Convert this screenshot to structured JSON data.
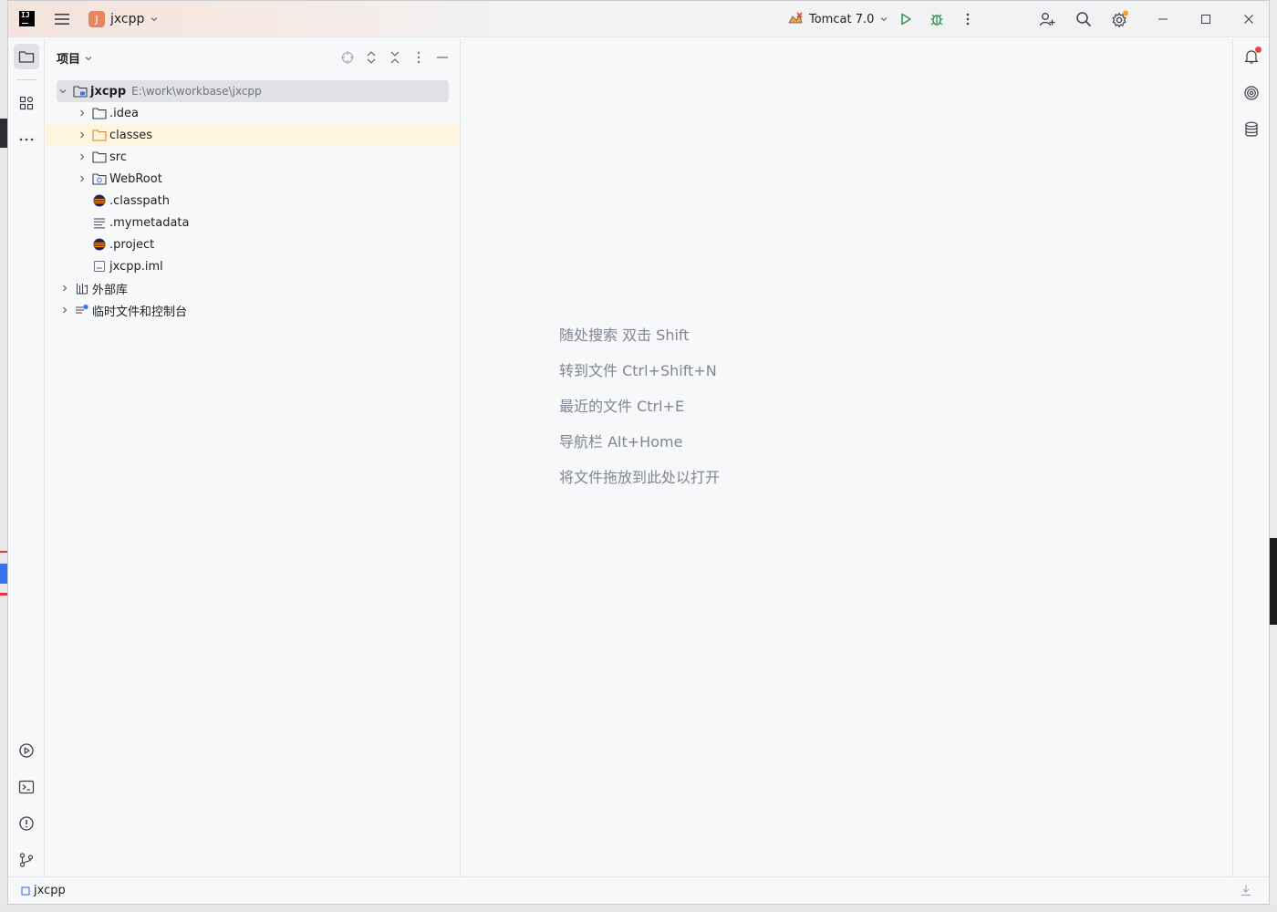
{
  "titlebar": {
    "project_initial": "J",
    "project_name": "jxcpp",
    "run_config": "Tomcat 7.0"
  },
  "project_panel": {
    "title": "项目",
    "tree": [
      {
        "name": "jxcpp",
        "path": "E:\\work\\workbase\\jxcpp",
        "icon": "module-folder-icon",
        "expanded": true,
        "level": 0
      },
      {
        "name": ".idea",
        "icon": "folder-icon",
        "expanded": false,
        "level": 1
      },
      {
        "name": "classes",
        "icon": "folder-orange-icon",
        "expanded": false,
        "level": 1,
        "highlight": true
      },
      {
        "name": "src",
        "icon": "folder-icon",
        "expanded": false,
        "level": 1
      },
      {
        "name": "WebRoot",
        "icon": "web-folder-icon",
        "expanded": false,
        "level": 1
      },
      {
        "name": ".classpath",
        "icon": "eclipse-file-icon",
        "level": 1
      },
      {
        "name": ".mymetadata",
        "icon": "text-file-icon",
        "level": 1
      },
      {
        "name": ".project",
        "icon": "eclipse-file-icon",
        "level": 1
      },
      {
        "name": "jxcpp.iml",
        "icon": "iml-file-icon",
        "level": 1
      },
      {
        "name": "外部库",
        "icon": "library-icon",
        "expanded": false,
        "level": 0
      },
      {
        "name": "临时文件和控制台",
        "icon": "scratches-icon",
        "expanded": false,
        "level": 0
      }
    ]
  },
  "editor": {
    "hints": [
      "随处搜索 双击 Shift",
      "转到文件 Ctrl+Shift+N",
      "最近的文件 Ctrl+E",
      "导航栏 Alt+Home",
      "将文件拖放到此处以打开"
    ]
  },
  "statusbar": {
    "breadcrumb": "jxcpp"
  },
  "colors": {
    "accent_orange": "#e5865f",
    "run_green": "#369650",
    "notification_red": "#e5493a",
    "selection_bg": "#dfe1e5",
    "highlight_bg": "#fdf5dd"
  }
}
